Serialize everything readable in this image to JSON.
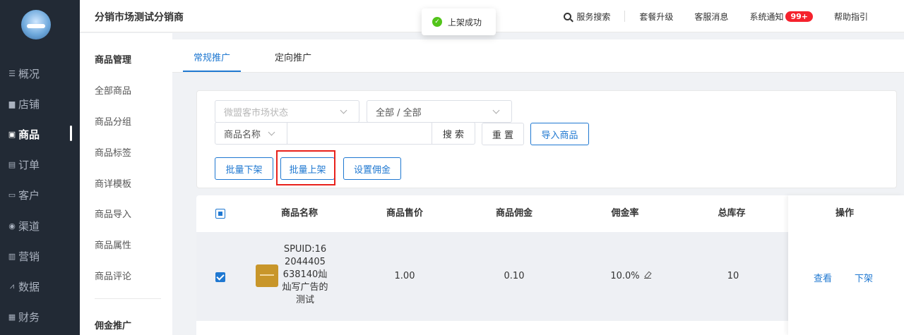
{
  "nav": {
    "items": [
      {
        "label": "概况",
        "icon": "overview-icon"
      },
      {
        "label": "店铺",
        "icon": "store-icon"
      },
      {
        "label": "商品",
        "icon": "product-icon",
        "active": true
      },
      {
        "label": "订单",
        "icon": "order-icon"
      },
      {
        "label": "客户",
        "icon": "customer-icon"
      },
      {
        "label": "渠道",
        "icon": "channel-icon"
      },
      {
        "label": "营销",
        "icon": "marketing-icon"
      },
      {
        "label": "数据",
        "icon": "data-icon"
      },
      {
        "label": "财务",
        "icon": "finance-icon"
      }
    ]
  },
  "topbar": {
    "shop_name": "分销市场测试分销商",
    "search_label": "服务搜索",
    "upgrade_label": "套餐升级",
    "service_msg_label": "客服消息",
    "notice_label": "系统通知",
    "notice_badge": "99+",
    "help_label": "帮助指引"
  },
  "toast": {
    "text": "上架成功"
  },
  "subnav": {
    "group1_title": "商品管理",
    "items": [
      "全部商品",
      "商品分组",
      "商品标签",
      "商详模板",
      "商品导入",
      "商品属性",
      "商品评论"
    ],
    "group2_title": "佣金推广"
  },
  "tabs": {
    "regular": "常规推广",
    "targeted": "定向推广"
  },
  "filters": {
    "market_status_placeholder": "微盟客市场状态",
    "category_value": "全部 / 全部",
    "field_select_value": "商品名称",
    "search_btn": "搜 索",
    "reset_btn": "重 置",
    "import_btn": "导入商品"
  },
  "batch": {
    "batch_off_btn": "批量下架",
    "batch_on_btn": "批量上架",
    "commission_btn": "设置佣金"
  },
  "table": {
    "headers": {
      "name": "商品名称",
      "price": "商品售价",
      "commission": "商品佣金",
      "rate": "佣金率",
      "stock": "总库存",
      "ops": "操作"
    },
    "rows": [
      {
        "name": "SPUID:162044405638140灿灿写广告的测试",
        "price": "1.00",
        "commission": "0.10",
        "rate": "10.0%",
        "stock": "10",
        "view": "查看",
        "off": "下架"
      }
    ]
  },
  "colors": {
    "accent": "#1f78d1",
    "nav_bg": "#222a35",
    "badge": "#f5222d",
    "highlight": "#e8211b"
  }
}
